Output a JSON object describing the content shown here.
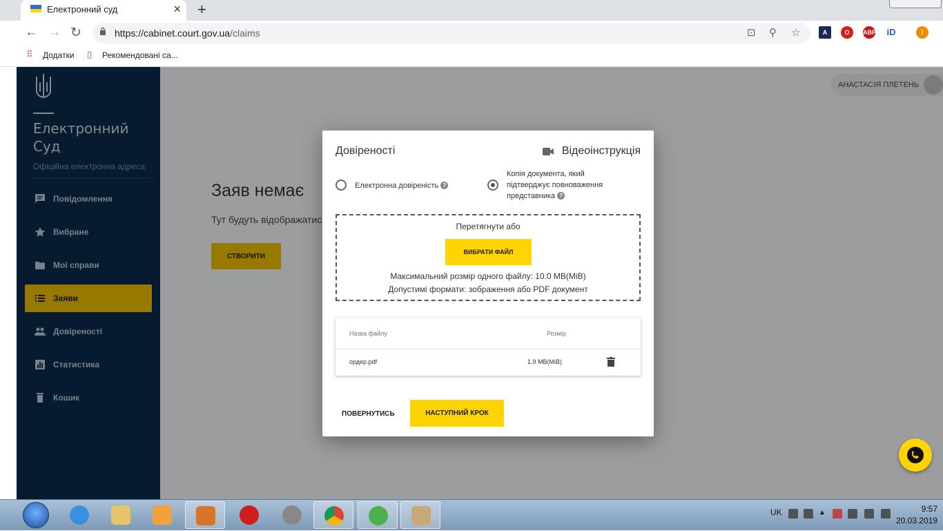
{
  "browser": {
    "tab_title": "Електронний суд",
    "url_host": "https://cabinet.court.gov.ua",
    "url_path": "/claims",
    "bookmarks": [
      "Додатки",
      "Рекомендовані са..."
    ]
  },
  "sidebar": {
    "brand_line1": "Електронний",
    "brand_line2": "Суд",
    "tagline": "Офіційна електронна адреса",
    "items": [
      {
        "label": "Повідомлення",
        "icon": "message-icon"
      },
      {
        "label": "Вибране",
        "icon": "star-icon"
      },
      {
        "label": "Мої справи",
        "icon": "folder-icon"
      },
      {
        "label": "Заяви",
        "icon": "list-icon",
        "active": true
      },
      {
        "label": "Довіреності",
        "icon": "people-icon"
      },
      {
        "label": "Статистика",
        "icon": "chart-icon"
      },
      {
        "label": "Кошик",
        "icon": "trash-icon"
      }
    ]
  },
  "user": {
    "name": "АНАСТАСІЯ ПЛЕТЕНЬ"
  },
  "main": {
    "title": "Заяв немає",
    "subtitle": "Тут будуть відображатися",
    "create_label": "СТВОРИТИ"
  },
  "modal": {
    "title": "Довіреності",
    "video_label": "Відеоінструкція",
    "radio_electronic": "Електронна довіреність",
    "radio_copy": [
      "Копія документа, який",
      "підтверджує повноваження",
      "представника"
    ],
    "drop_text": "Перетягнути або",
    "choose_label": "ВИБРАТИ ФАЙЛ",
    "max_size": "Максимальний розмір одного файлу: 10.0 MB(MiB)",
    "formats": "Допустимі формати: зображення або PDF документ",
    "table_headers": {
      "name": "Назва файлу",
      "size": "Розмір"
    },
    "files": [
      {
        "name": "ордер.pdf",
        "size": "1.9 MB(MiB)"
      }
    ],
    "back_label": "ПОВЕРНУТИСЬ",
    "next_label": "НАСТУПНИЙ КРОК"
  },
  "taskbar": {
    "lang": "UK",
    "time": "9:57",
    "date": "20.03.2019"
  },
  "colors": {
    "sidebar_bg": "#0b2a4a",
    "accent_yellow": "#ffd400",
    "active_nav": "#e5b800"
  }
}
